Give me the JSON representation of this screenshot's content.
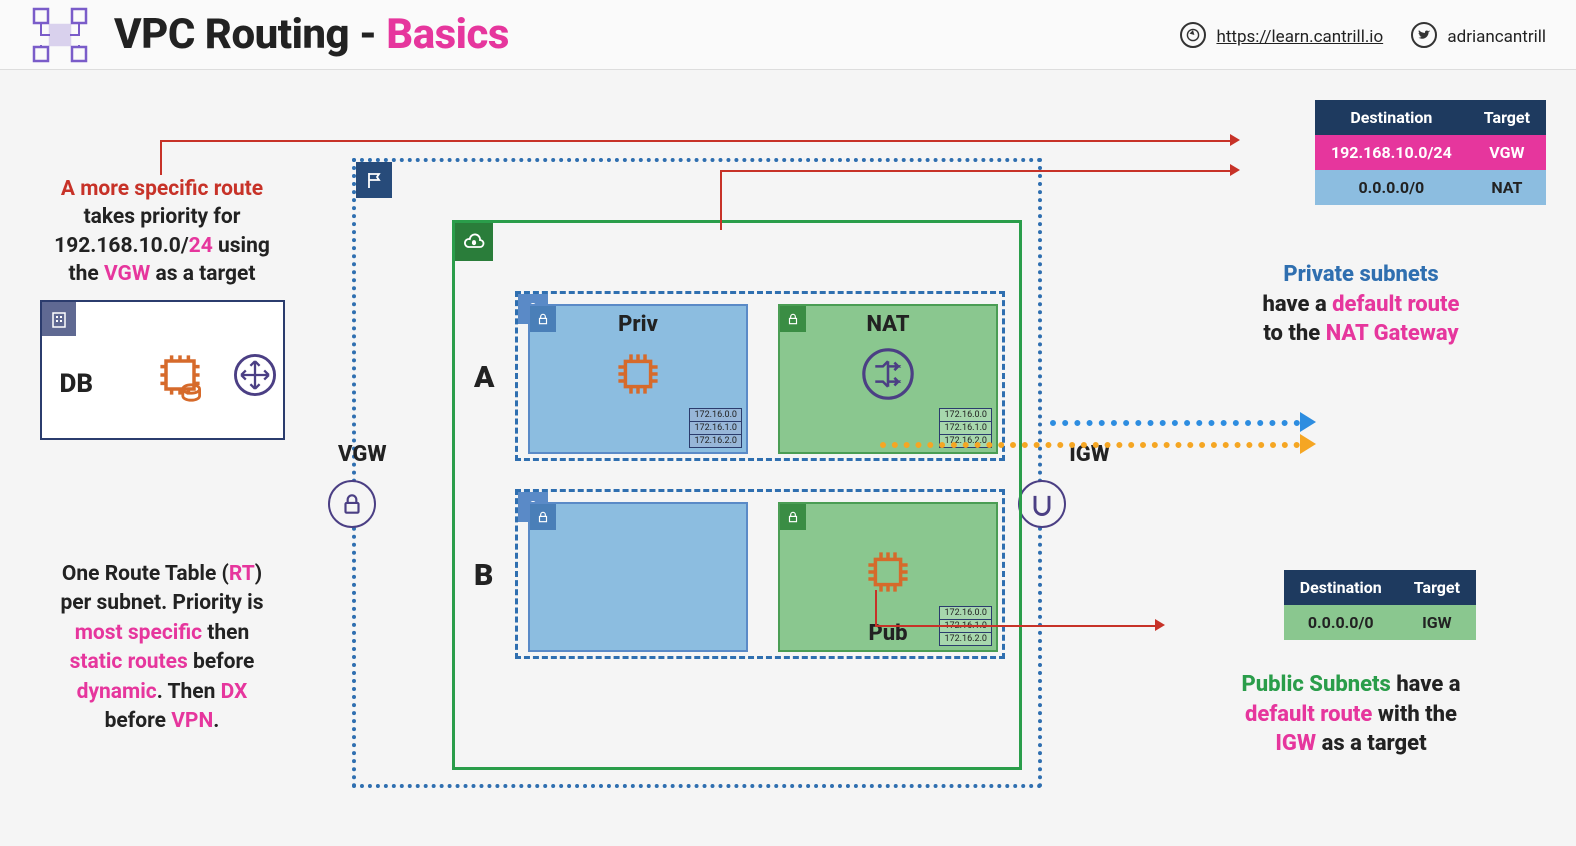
{
  "header": {
    "title_1": "VPC Routing - ",
    "title_2": "Basics",
    "link_url": "https://learn.cantrill.io",
    "twitter": "adriancantrill"
  },
  "left": {
    "line1_a": "A more specific route",
    "line1_b": "takes priority for",
    "line1_c1": "192.168.10.0/",
    "line1_c2": "24",
    "line1_c3": " using",
    "line1_d1": "the ",
    "line1_d2": "VGW",
    "line1_d3": " as a target",
    "db_label": "DB"
  },
  "left2": {
    "a": "One Route Table (",
    "rt": "RT",
    "b": ")",
    "c": "per subnet. Priority is",
    "d": "most specific",
    "e": " then",
    "f": "static routes",
    "g": " before",
    "h": "dynamic",
    "i": ". Then ",
    "j": "DX",
    "k": "before ",
    "l": "VPN",
    "m": "."
  },
  "az": {
    "a": "A",
    "b": "B"
  },
  "subnet": {
    "priv": "Priv",
    "nat": "NAT",
    "pub": "Pub",
    "rt1": "172.16.0.0",
    "rt2": "172.16.1.0",
    "rt3": "172.16.2.0"
  },
  "gw": {
    "vgw": "VGW",
    "igw": "IGW"
  },
  "table_top": {
    "h1": "Destination",
    "h2": "Target",
    "r1c1": "192.168.10.0/24",
    "r1c2": "VGW",
    "r2c1": "0.0.0.0/0",
    "r2c2": "NAT"
  },
  "table_bot": {
    "h1": "Destination",
    "h2": "Target",
    "r1c1": "0.0.0.0/0",
    "r1c2": "IGW"
  },
  "ann1": {
    "a": "Private subnets",
    "b": "have a ",
    "c": "default route",
    "d": "to the ",
    "e": "NAT Gateway"
  },
  "ann2": {
    "a": "Public Subnets",
    "b": " have a",
    "c": "default route",
    "d": " with the",
    "e": "IGW",
    "f": " as a target"
  }
}
